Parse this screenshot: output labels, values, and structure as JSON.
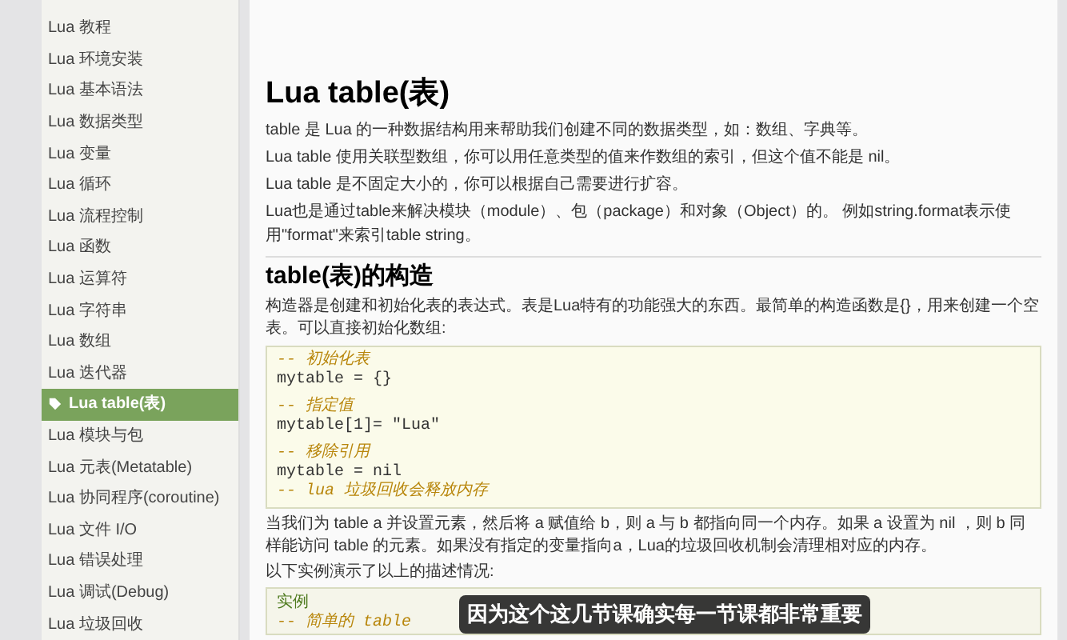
{
  "sidebar": {
    "items": [
      {
        "label": "Lua 教程",
        "selected": false
      },
      {
        "label": "Lua 环境安装",
        "selected": false
      },
      {
        "label": "Lua 基本语法",
        "selected": false
      },
      {
        "label": "Lua 数据类型",
        "selected": false
      },
      {
        "label": "Lua 变量",
        "selected": false
      },
      {
        "label": "Lua 循环",
        "selected": false
      },
      {
        "label": "Lua 流程控制",
        "selected": false
      },
      {
        "label": "Lua 函数",
        "selected": false
      },
      {
        "label": "Lua 运算符",
        "selected": false
      },
      {
        "label": "Lua 字符串",
        "selected": false
      },
      {
        "label": "Lua 数组",
        "selected": false
      },
      {
        "label": "Lua 迭代器",
        "selected": false
      },
      {
        "label": "Lua table(表)",
        "selected": true
      },
      {
        "label": "Lua 模块与包",
        "selected": false
      },
      {
        "label": "Lua 元表(Metatable)",
        "selected": false
      },
      {
        "label": "Lua 协同程序(coroutine)",
        "selected": false
      },
      {
        "label": "Lua 文件 I/O",
        "selected": false
      },
      {
        "label": "Lua 错误处理",
        "selected": false
      },
      {
        "label": "Lua 调试(Debug)",
        "selected": false
      },
      {
        "label": "Lua 垃圾回收",
        "selected": false
      }
    ]
  },
  "article": {
    "title": "Lua table(表)",
    "paragraphs": [
      "table 是 Lua 的一种数据结构用来帮助我们创建不同的数据类型，如：数组、字典等。",
      "Lua table 使用关联型数组，你可以用任意类型的值来作数组的索引，但这个值不能是 nil。",
      "Lua table 是不固定大小的，你可以根据自己需要进行扩容。",
      "Lua也是通过table来解决模块（module）、包（package）和对象（Object）的。 例如string.format表示使用\"format\"来索引table string。"
    ],
    "section": {
      "heading": "table(表)的构造",
      "intro": "构造器是创建和初始化表的表达式。表是Lua特有的功能强大的东西。最简单的构造函数是{}，用来创建一个空表。可以直接初始化数组:",
      "code_groups": [
        {
          "lines": [
            {
              "kind": "comment",
              "text": "-- 初始化表"
            },
            {
              "kind": "code",
              "text": "mytable = {}"
            }
          ]
        },
        {
          "lines": [
            {
              "kind": "comment",
              "text": "-- 指定值"
            },
            {
              "kind": "code",
              "text": "mytable[1]= \"Lua\""
            }
          ]
        },
        {
          "lines": [
            {
              "kind": "comment",
              "text": "-- 移除引用"
            },
            {
              "kind": "code",
              "text": "mytable = nil"
            },
            {
              "kind": "comment",
              "text": "-- lua 垃圾回收会释放内存"
            }
          ]
        }
      ],
      "paragraphs": [
        "当我们为 table a 并设置元素，然后将 a 赋值给 b，则 a 与 b 都指向同一个内存。如果 a 设置为 nil ，则 b 同样能访问 table 的元素。如果没有指定的变量指向a，Lua的垃圾回收机制会清理相对应的内存。",
        "以下实例演示了以上的描述情况:"
      ],
      "example": {
        "label": "实例",
        "lines": [
          {
            "kind": "comment",
            "text": "-- 简单的 table"
          }
        ]
      }
    }
  },
  "subtitle": "因为这个这几节课确实每一节课都非常重要"
}
